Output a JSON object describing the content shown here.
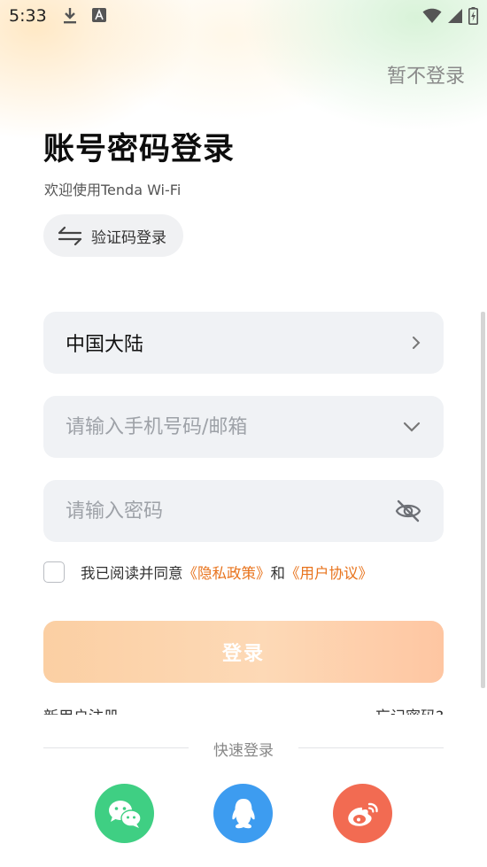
{
  "status_bar": {
    "time": "5:33"
  },
  "header": {
    "skip_label": "暂不登录"
  },
  "login": {
    "title": "账号密码登录",
    "subtitle": "欢迎使用Tenda Wi-Fi",
    "switch_label": "验证码登录"
  },
  "form": {
    "region_value": "中国大陆",
    "account_placeholder": "请输入手机号码/邮箱",
    "password_placeholder": "请输入密码"
  },
  "agreement": {
    "prefix": "我已阅读并同意",
    "privacy_link": "《隐私政策》",
    "conjunction": "和",
    "user_link": "《用户协议》"
  },
  "login_button": "登录",
  "links": {
    "register": "新用户注册",
    "forgot": "忘记密码?"
  },
  "quick_login": {
    "label": "快速登录",
    "providers": [
      {
        "name": "wechat",
        "icon": "wechat-icon",
        "color": "#3fcf83"
      },
      {
        "name": "qq",
        "icon": "qq-icon",
        "color": "#3d9cf0"
      },
      {
        "name": "weibo",
        "icon": "weibo-icon",
        "color": "#f26b52"
      }
    ]
  },
  "colors": {
    "accent": "#e8731c",
    "button": "#fdd3ac",
    "field_bg": "#f0f2f5"
  }
}
